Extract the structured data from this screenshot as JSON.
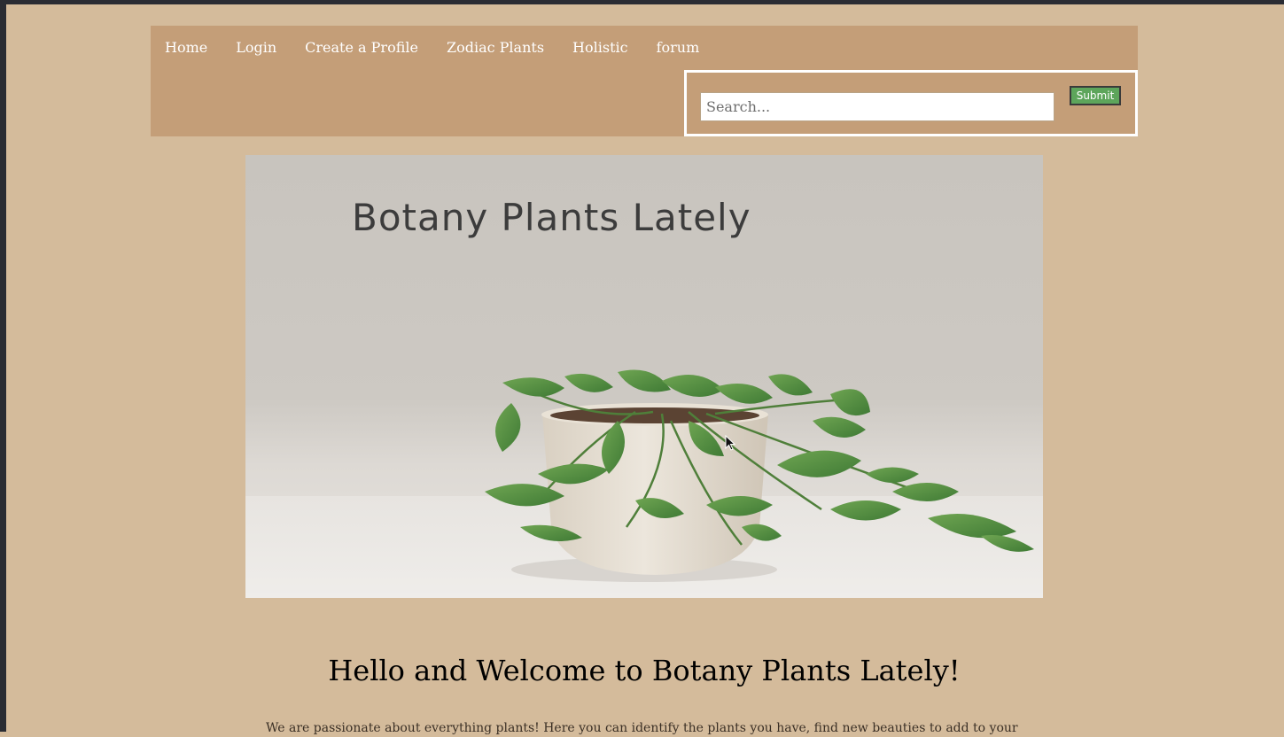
{
  "nav": {
    "links": [
      {
        "label": "Home"
      },
      {
        "label": "Login"
      },
      {
        "label": "Create a Profile"
      },
      {
        "label": "Zodiac Plants"
      },
      {
        "label": "Holistic"
      },
      {
        "label": "forum"
      }
    ]
  },
  "search": {
    "placeholder": "Search...",
    "value": "",
    "submit_label": "Submit"
  },
  "hero": {
    "title": "Botany Plants Lately"
  },
  "main": {
    "welcome_heading": "Hello and Welcome to Botany Plants Lately!",
    "intro_text": "We are passionate about everything plants! Here you can identify the plants you have, find new beauties to add to your"
  },
  "colors": {
    "page_background": "#d4bb9b",
    "nav_background": "#c49e78",
    "submit_button": "#5da55b"
  },
  "icons": {
    "cursor": "mouse-pointer-icon"
  }
}
